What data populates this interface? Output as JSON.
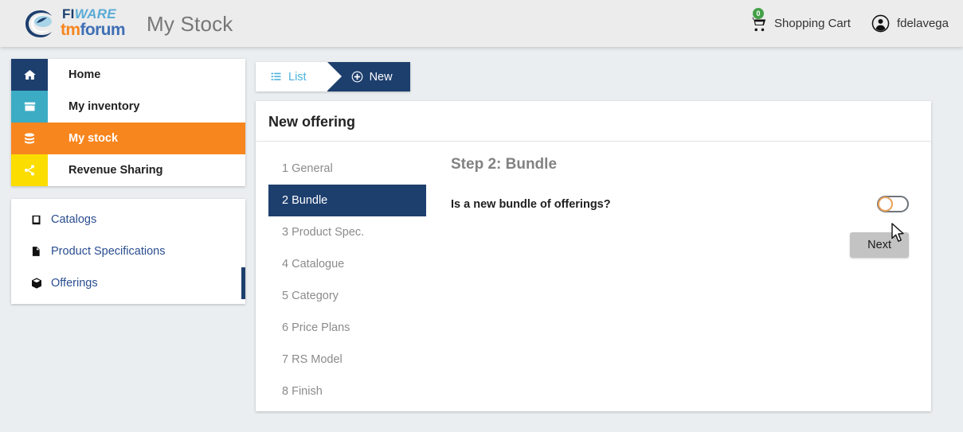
{
  "header": {
    "logo": {
      "fiware_first": "FI",
      "fiware_second": "WARE",
      "tmforum_first": "tm",
      "tmforum_second": "forum",
      "icon": "fiware-swirl-icon"
    },
    "app_title": "My Stock",
    "cart": {
      "label": "Shopping Cart",
      "badge": "0",
      "icon": "shopping-cart-icon"
    },
    "user": {
      "name": "fdelavega",
      "icon": "user-circle-icon"
    }
  },
  "sidebar": {
    "items": [
      {
        "label": "Home",
        "icon": "home-icon",
        "icon_bg": "#1d3f6e",
        "active": false
      },
      {
        "label": "My inventory",
        "icon": "archive-box-icon",
        "icon_bg": "#3cacc4",
        "active": false
      },
      {
        "label": "My stock",
        "icon": "database-icon",
        "icon_bg": "#f7861f",
        "active": true
      },
      {
        "label": "Revenue Sharing",
        "icon": "share-icon",
        "icon_bg": "#fbdd00",
        "active": false
      }
    ],
    "submenu": [
      {
        "label": "Catalogs",
        "icon": "book-icon",
        "selected": false
      },
      {
        "label": "Product Specifications",
        "icon": "file-icon",
        "selected": false
      },
      {
        "label": "Offerings",
        "icon": "cube-icon",
        "selected": true
      }
    ]
  },
  "breadcrumb": {
    "list_label": "List",
    "list_icon": "list-icon",
    "new_label": "New",
    "new_icon": "plus-circle-icon"
  },
  "panel": {
    "title": "New offering",
    "steps": [
      {
        "label": "1 General",
        "active": false
      },
      {
        "label": "2 Bundle",
        "active": true
      },
      {
        "label": "3 Product Spec.",
        "active": false
      },
      {
        "label": "4 Catalogue",
        "active": false
      },
      {
        "label": "5 Category",
        "active": false
      },
      {
        "label": "6 Price Plans",
        "active": false
      },
      {
        "label": "7 RS Model",
        "active": false
      },
      {
        "label": "8 Finish",
        "active": false
      }
    ],
    "step_heading": "Step 2: Bundle",
    "question_label": "Is a new bundle of offerings?",
    "toggle_state": "off",
    "next_label": "Next"
  },
  "colors": {
    "accent_orange": "#f7861f",
    "navy": "#1d3f6e",
    "teal": "#3cacc4",
    "yellow": "#fbdd00",
    "badge_green": "#43a047",
    "link_blue": "#2a4d8f",
    "page_bg": "#eaeef0"
  }
}
